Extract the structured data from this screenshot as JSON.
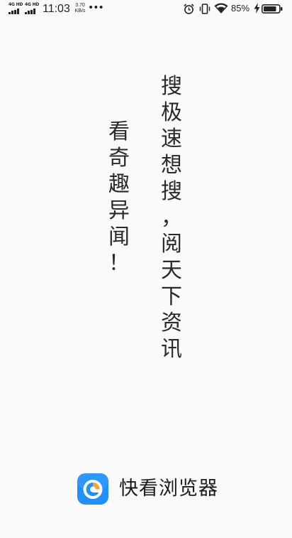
{
  "status_bar": {
    "signal_1_label": "4G HD",
    "signal_2_label": "4G HD",
    "time": "11:03",
    "net_speed_value": "3.70",
    "net_speed_unit": "KB/s",
    "more_indicator": "•••",
    "battery_percent": "85%",
    "icons": [
      "signal-icon",
      "alarm-icon",
      "vibrate-icon",
      "wifi-icon",
      "charging-bolt-icon",
      "battery-icon"
    ]
  },
  "slogan": {
    "right_column": [
      "搜",
      "极",
      "速",
      "想",
      "搜",
      "，",
      "阅",
      "天",
      "下",
      "资",
      "讯"
    ],
    "left_column": [
      "看",
      "奇",
      "趣",
      "异",
      "闻",
      "！"
    ]
  },
  "brand": {
    "app_name": "快看浏览器",
    "logo_icon": "kuaikan-browser-logo-icon",
    "colors": {
      "logo_blue": "#1e90ff",
      "logo_orange": "#ffa31a",
      "text": "#1a1a1a",
      "background": "#fafafa"
    }
  }
}
